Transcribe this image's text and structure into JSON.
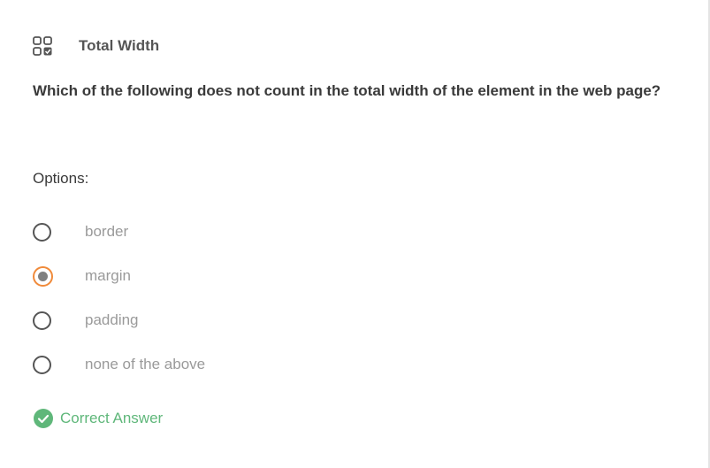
{
  "header": {
    "icon": "quiz-grid-check-icon",
    "title": "Total Width"
  },
  "question": {
    "text": "Which of the following does not count in the total width of the element in the web page?"
  },
  "options": {
    "label": "Options:",
    "items": [
      {
        "label": "border",
        "selected": false
      },
      {
        "label": "margin",
        "selected": true
      },
      {
        "label": "padding",
        "selected": false
      },
      {
        "label": "none of the above",
        "selected": false
      }
    ]
  },
  "result": {
    "icon": "check-circle-icon",
    "text": "Correct Answer"
  },
  "colors": {
    "selected_ring": "#f08a3a",
    "selected_dot": "#808080",
    "correct": "#5fb77a",
    "option_text": "#9a9a9a"
  }
}
